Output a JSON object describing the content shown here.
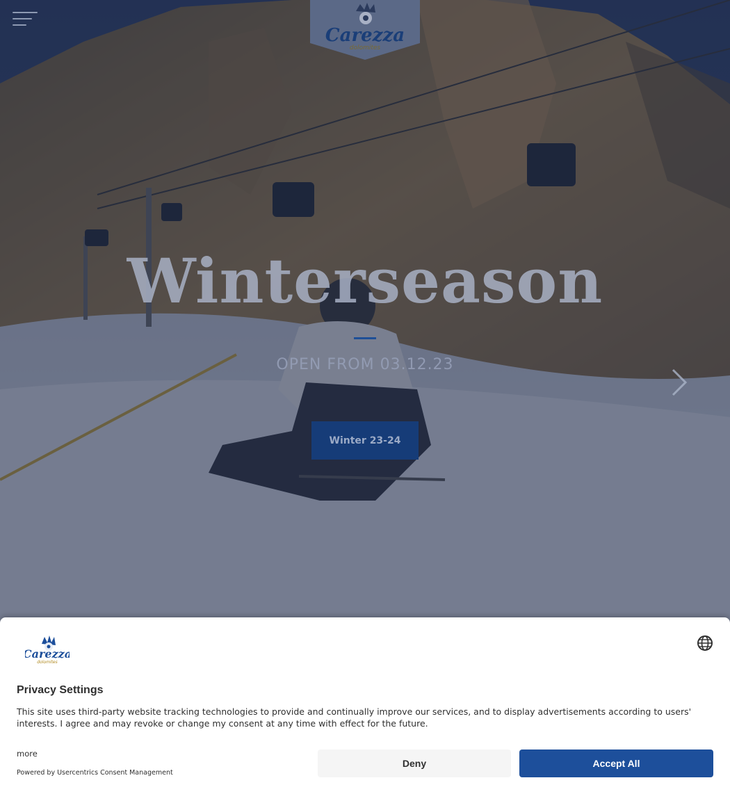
{
  "brand": {
    "logo_word": "Carezza",
    "logo_sub": "dolomites",
    "primary_color": "#1d4f9b",
    "accent_color": "#f0a500"
  },
  "header": {
    "menu_icon": "hamburger-menu-icon"
  },
  "hero": {
    "title": "Winterseason",
    "subtitle": "OPEN FROM 03.12.23",
    "button_label": "Winter 23-24",
    "next_icon": "chevron-right-icon"
  },
  "consent": {
    "title": "Privacy Settings",
    "text": "This site uses third-party website tracking technologies to provide and continually improve our services, and to display advertisements according to users' interests. I agree and may revoke or change my consent at any time with effect for the future.",
    "more_label": "more",
    "powered_by": "Powered by Usercentrics Consent Management",
    "deny_label": "Deny",
    "accept_label": "Accept All",
    "language_icon": "globe-icon"
  }
}
